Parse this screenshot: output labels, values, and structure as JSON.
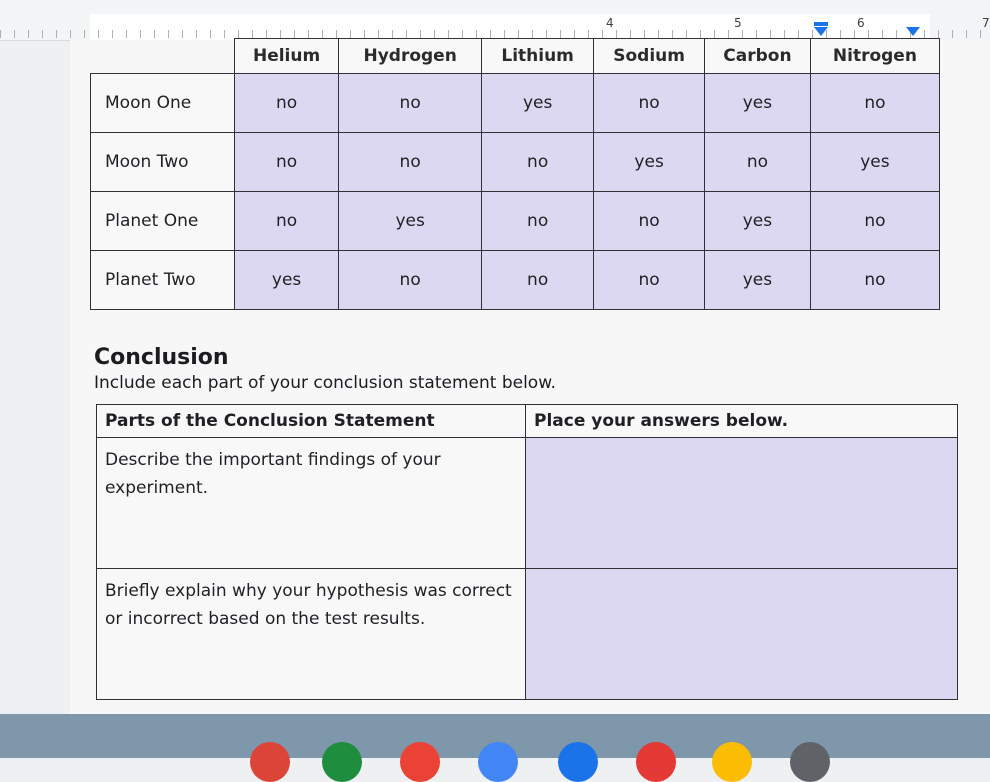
{
  "ruler": {
    "numbers": [
      "4",
      "5",
      "6",
      "7"
    ]
  },
  "data_table": {
    "columns": [
      "Helium",
      "Hydrogen",
      "Lithium",
      "Sodium",
      "Carbon",
      "Nitrogen"
    ],
    "rows": [
      {
        "label": "Moon One",
        "cells": [
          "no",
          "no",
          "yes",
          "no",
          "yes",
          "no"
        ]
      },
      {
        "label": "Moon Two",
        "cells": [
          "no",
          "no",
          "no",
          "yes",
          "no",
          "yes"
        ]
      },
      {
        "label": "Planet One",
        "cells": [
          "no",
          "yes",
          "no",
          "no",
          "yes",
          "no"
        ]
      },
      {
        "label": "Planet Two",
        "cells": [
          "yes",
          "no",
          "no",
          "no",
          "yes",
          "no"
        ]
      }
    ]
  },
  "conclusion": {
    "title": "Conclusion",
    "instruction": "Include each part of your conclusion statement below.",
    "header_left": "Parts of the Conclusion Statement",
    "header_right": "Place your answers below.",
    "rows": [
      {
        "prompt": "Describe the important findings of your experiment.",
        "answer": ""
      },
      {
        "prompt": "Briefly explain why your hypothesis was correct or incorrect based on the test results.",
        "answer": ""
      }
    ]
  },
  "dock": {
    "icons": [
      {
        "name": "chrome-icon",
        "color": "#db4437"
      },
      {
        "name": "classroom-icon",
        "color": "#1e8e3e"
      },
      {
        "name": "gmail-icon",
        "color": "#ea4335"
      },
      {
        "name": "calendar-icon",
        "color": "#4285f4"
      },
      {
        "name": "files-icon",
        "color": "#1a73e8"
      },
      {
        "name": "youtube-icon",
        "color": "#e53935"
      },
      {
        "name": "photos-icon",
        "color": "#fbbc04"
      },
      {
        "name": "settings-icon",
        "color": "#5f6368"
      }
    ]
  }
}
